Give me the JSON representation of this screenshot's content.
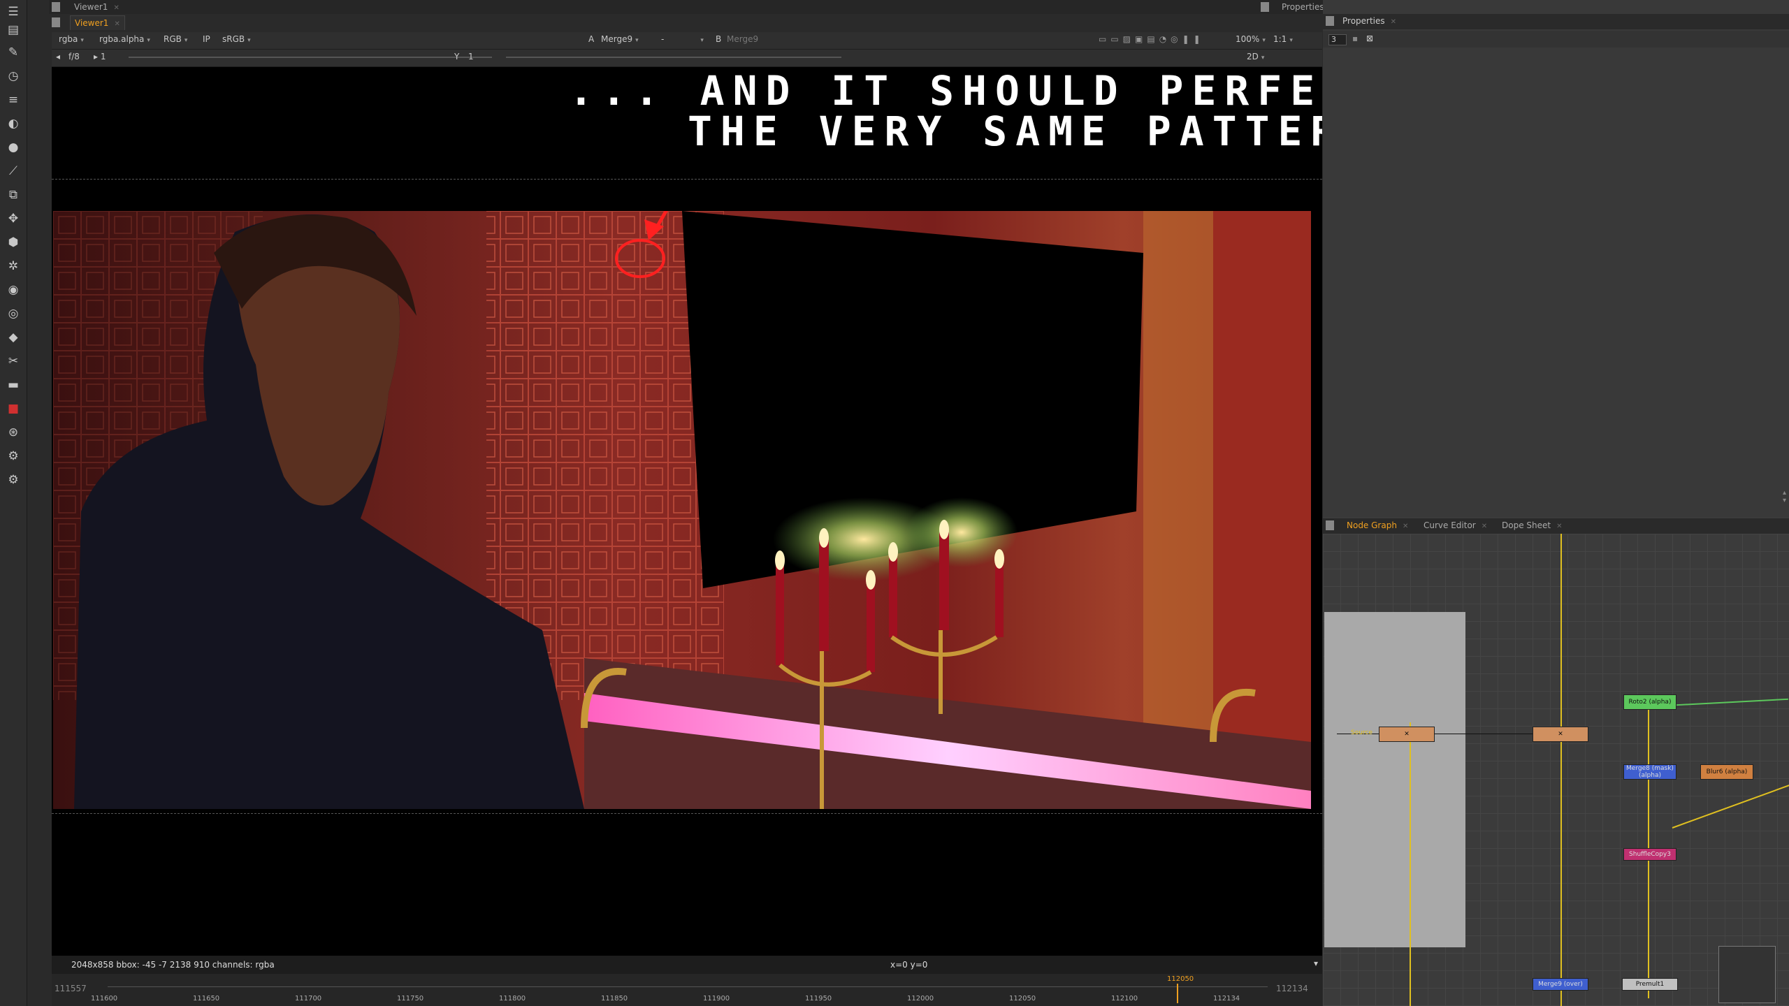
{
  "viewer": {
    "outer_tab": "Viewer1",
    "inner_tab": "Viewer1",
    "channels": "rgba",
    "alpha_channel": "rgba.alpha",
    "display": "RGB",
    "ip_label": "IP",
    "lut": "sRGB",
    "input_a_label": "A",
    "input_a": "Merge9",
    "blend_mode": "-",
    "input_b_label": "B",
    "input_b": "Merge9",
    "zoom": "100%",
    "ratio": "1:1",
    "fstop": "f/8",
    "frame_gain": "1",
    "gamma_label": "Y",
    "gamma": "1",
    "view_mode": "2D"
  },
  "annotation": {
    "line1": "... AND IT SHOULD PERFECTLY MATCH",
    "line2": "THE VERY SAME PATTERN ON FOOTAGE"
  },
  "status": {
    "format": "2048x858  bbox: -45 -7 2138 910  channels: rgba",
    "coords": "x=0 y=0"
  },
  "timeline": {
    "start": "111557",
    "end": "112134",
    "current": "112050",
    "ticks": [
      "111557",
      "111600",
      "111650",
      "111700",
      "111750",
      "111800",
      "111850",
      "111900",
      "111950",
      "112000",
      "112050",
      "112100",
      "112134"
    ]
  },
  "properties": {
    "outer_tab": "Properties",
    "inner_tab": "Properties",
    "max_panels": "3"
  },
  "graph_tabs": [
    "Node Graph",
    "Curve Editor",
    "Dope Sheet"
  ],
  "nodes": {
    "roto": "Roto2\n(alpha)",
    "merge8": "Merge8 (mask)\n(alpha)",
    "blur": "Blur6\n(alpha)",
    "shuffle": "ShuffleCopy3",
    "merge9": "Merge9 (over)",
    "premult": "Premult1",
    "source": "Source"
  },
  "colors": {
    "accent": "#f0a020",
    "roto": "#5cc85c",
    "merge": "#3f5fcf",
    "blur": "#d08040",
    "shuffle": "#c03070",
    "pipe": "#e0c020"
  }
}
